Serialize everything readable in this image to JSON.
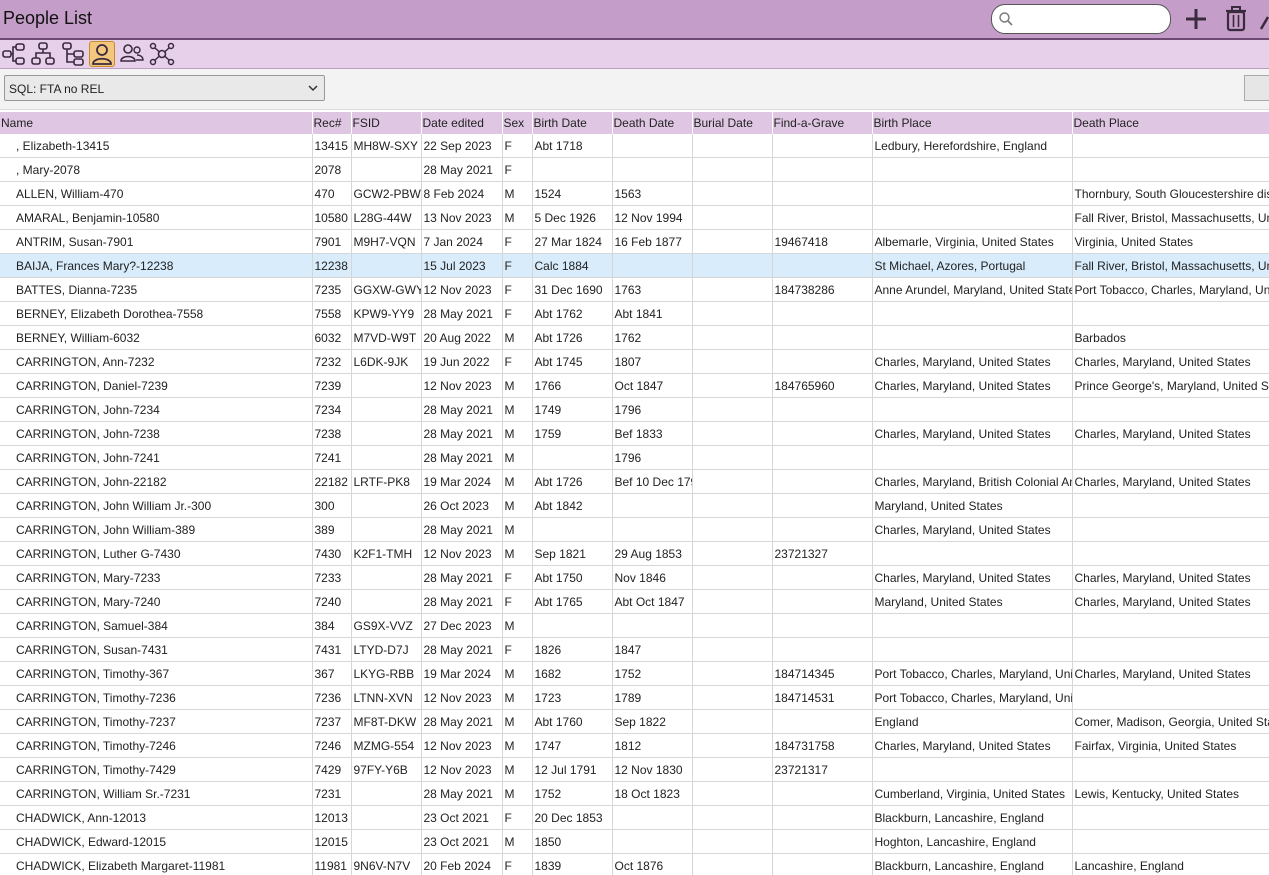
{
  "window": {
    "title": "People List"
  },
  "search": {
    "placeholder": "",
    "value": ""
  },
  "filter": {
    "selected": "SQL: FTA no REL"
  },
  "toolbar": {
    "icons": [
      "ancestors-tree-icon",
      "descendants-tree-icon",
      "family-tree-icon",
      "person-icon",
      "people-icon",
      "network-icon"
    ],
    "active": "person-icon"
  },
  "colors": {
    "title_bar": "#c49dc8",
    "toolbar": "#e6d0ea",
    "header": "#dfc7e3",
    "selected_row": "#d9ecfb",
    "active_icon": "#f4c77e"
  },
  "table": {
    "columns": [
      "Name",
      "Rec#",
      "FSID",
      "Date edited",
      "Sex",
      "Birth Date",
      "Death Date",
      "Burial Date",
      "Find-a-Grave",
      "Birth Place",
      "Death Place"
    ],
    "selected_row": 5,
    "rows": [
      [
        ", Elizabeth-13415",
        "13415",
        "MH8W-SXY",
        "22 Sep 2023",
        "F",
        "Abt 1718",
        "",
        "",
        "",
        "Ledbury, Herefordshire, England",
        ""
      ],
      [
        ", Mary-2078",
        "2078",
        "",
        "28 May 2021",
        "F",
        "",
        "",
        "",
        "",
        "",
        ""
      ],
      [
        "ALLEN, William-470",
        "470",
        "GCW2-PBW",
        "8 Feb 2024",
        "M",
        "1524",
        "1563",
        "",
        "",
        "",
        "Thornbury, South Gloucestershire dis"
      ],
      [
        "AMARAL, Benjamin-10580",
        "10580",
        "L28G-44W",
        "13 Nov 2023",
        "M",
        "5 Dec 1926",
        "12 Nov 1994",
        "",
        "",
        "",
        "Fall River, Bristol, Massachusetts, Unit"
      ],
      [
        "ANTRIM, Susan-7901",
        "7901",
        "M9H7-VQN",
        "7 Jan 2024",
        "F",
        "27 Mar 1824",
        "16 Feb 1877",
        "",
        "19467418",
        "Albemarle, Virginia, United States",
        "Virginia, United States"
      ],
      [
        "BAIJA, Frances Mary?-12238",
        "12238",
        "",
        "15 Jul 2023",
        "F",
        "Calc 1884",
        "",
        "",
        "",
        "St  Michael, Azores, Portugal",
        "Fall River, Bristol, Massachusetts, Unit"
      ],
      [
        "BATTES, Dianna-7235",
        "7235",
        "GGXW-GWY",
        "12 Nov 2023",
        "F",
        "31 Dec 1690",
        "1763",
        "",
        "184738286",
        "Anne Arundel, Maryland, United State",
        "Port Tobacco, Charles, Maryland, Unit"
      ],
      [
        "BERNEY, Elizabeth Dorothea-7558",
        "7558",
        "KPW9-YY9",
        "28 May 2021",
        "F",
        "Abt 1762",
        "Abt 1841",
        "",
        "",
        "",
        ""
      ],
      [
        "BERNEY, William-6032",
        "6032",
        "M7VD-W9T",
        "20 Aug 2022",
        "M",
        "Abt 1726",
        "1762",
        "",
        "",
        "",
        "Barbados"
      ],
      [
        "CARRINGTON, Ann-7232",
        "7232",
        "L6DK-9JK",
        "19 Jun 2022",
        "F",
        "Abt 1745",
        "1807",
        "",
        "",
        "Charles, Maryland, United States",
        "Charles, Maryland, United States"
      ],
      [
        "CARRINGTON, Daniel-7239",
        "7239",
        "",
        "12 Nov 2023",
        "M",
        "1766",
        "Oct 1847",
        "",
        "184765960",
        "Charles, Maryland, United States",
        "Prince George's, Maryland, United Sta"
      ],
      [
        "CARRINGTON, John-7234",
        "7234",
        "",
        "28 May 2021",
        "M",
        "1749",
        "1796",
        "",
        "",
        "",
        ""
      ],
      [
        "CARRINGTON, John-7238",
        "7238",
        "",
        "28 May 2021",
        "M",
        "1759",
        "Bef 1833",
        "",
        "",
        "Charles, Maryland, United States",
        "Charles, Maryland, United States"
      ],
      [
        "CARRINGTON, John-7241",
        "7241",
        "",
        "28 May 2021",
        "M",
        "",
        "1796",
        "",
        "",
        "",
        ""
      ],
      [
        "CARRINGTON, John-22182",
        "22182",
        "LRTF-PK8",
        "19 Mar 2024",
        "M",
        "Abt 1726",
        "Bef 10 Dec 179",
        "",
        "",
        "Charles, Maryland, British Colonial An",
        "Charles, Maryland, United States"
      ],
      [
        "CARRINGTON, John William Jr.-300",
        "300",
        "",
        "26 Oct 2023",
        "M",
        "Abt 1842",
        "",
        "",
        "",
        "Maryland, United States",
        ""
      ],
      [
        "CARRINGTON, John William-389",
        "389",
        "",
        "28 May 2021",
        "M",
        "",
        "",
        "",
        "",
        "Charles, Maryland, United States",
        ""
      ],
      [
        "CARRINGTON, Luther G-7430",
        "7430",
        "K2F1-TMH",
        "12 Nov 2023",
        "M",
        "Sep 1821",
        "29 Aug 1853",
        "",
        "23721327",
        "",
        ""
      ],
      [
        "CARRINGTON, Mary-7233",
        "7233",
        "",
        "28 May 2021",
        "F",
        "Abt 1750",
        "Nov 1846",
        "",
        "",
        "Charles, Maryland, United States",
        "Charles, Maryland, United States"
      ],
      [
        "CARRINGTON, Mary-7240",
        "7240",
        "",
        "28 May 2021",
        "F",
        "Abt 1765",
        "Abt Oct 1847",
        "",
        "",
        "Maryland, United States",
        "Charles, Maryland, United States"
      ],
      [
        "CARRINGTON, Samuel-384",
        "384",
        "GS9X-VVZ",
        "27 Dec 2023",
        "M",
        "",
        "",
        "",
        "",
        "",
        ""
      ],
      [
        "CARRINGTON, Susan-7431",
        "7431",
        "LTYD-D7J",
        "28 May 2021",
        "F",
        "1826",
        "1847",
        "",
        "",
        "",
        ""
      ],
      [
        "CARRINGTON, Timothy-367",
        "367",
        "LKYG-RBB",
        "19 Mar 2024",
        "M",
        "1682",
        "1752",
        "",
        "184714345",
        "Port Tobacco, Charles, Maryland, Unit",
        "Charles, Maryland, United States"
      ],
      [
        "CARRINGTON, Timothy-7236",
        "7236",
        "LTNN-XVN",
        "12 Nov 2023",
        "M",
        "1723",
        "1789",
        "",
        "184714531",
        "Port Tobacco, Charles, Maryland, Unit",
        ""
      ],
      [
        "CARRINGTON, Timothy-7237",
        "7237",
        "MF8T-DKW",
        "28 May 2021",
        "M",
        "Abt 1760",
        "Sep 1822",
        "",
        "",
        "England",
        "Comer, Madison, Georgia, United Sta"
      ],
      [
        "CARRINGTON, Timothy-7246",
        "7246",
        "MZMG-554",
        "12 Nov 2023",
        "M",
        "1747",
        "1812",
        "",
        "184731758",
        "Charles, Maryland, United States",
        "Fairfax, Virginia, United States"
      ],
      [
        "CARRINGTON, Timothy-7429",
        "7429",
        "97FY-Y6B",
        "12 Nov 2023",
        "M",
        "12 Jul 1791",
        "12 Nov 1830",
        "",
        "23721317",
        "",
        ""
      ],
      [
        "CARRINGTON, William Sr.-7231",
        "7231",
        "",
        "28 May 2021",
        "M",
        "1752",
        "18 Oct 1823",
        "",
        "",
        "Cumberland, Virginia, United States",
        "Lewis, Kentucky, United States"
      ],
      [
        "CHADWICK, Ann-12013",
        "12013",
        "",
        "23 Oct 2021",
        "F",
        "20 Dec 1853",
        "",
        "",
        "",
        "Blackburn, Lancashire, England",
        ""
      ],
      [
        "CHADWICK, Edward-12015",
        "12015",
        "",
        "23 Oct 2021",
        "M",
        "1850",
        "",
        "",
        "",
        "Hoghton, Lancashire, England",
        ""
      ],
      [
        "CHADWICK, Elizabeth Margaret-11981",
        "11981",
        "9N6V-N7V",
        "20 Feb 2024",
        "F",
        "1839",
        "Oct 1876",
        "",
        "",
        "Blackburn, Lancashire, England",
        "Lancashire, England"
      ]
    ]
  }
}
